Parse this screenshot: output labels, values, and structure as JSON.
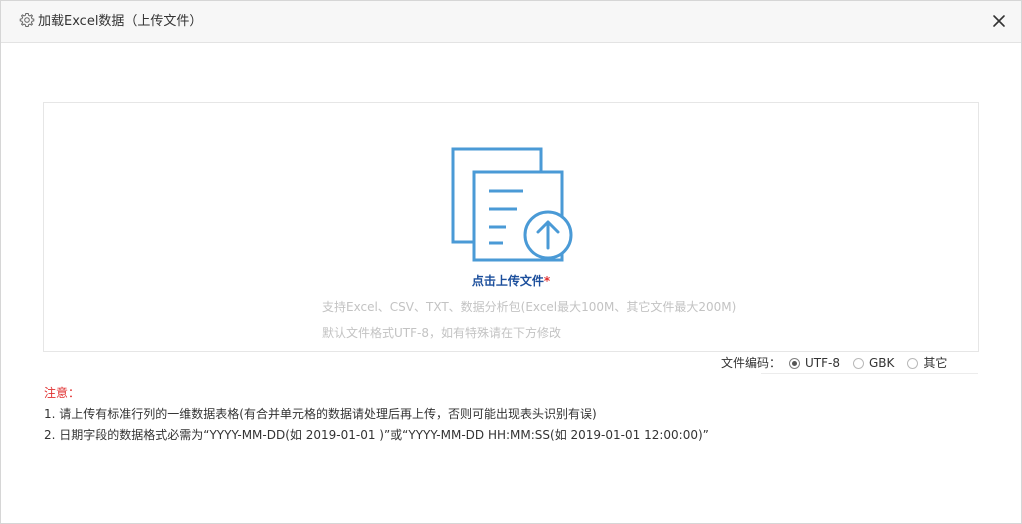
{
  "dialog": {
    "title": "加载Excel数据（上传文件）",
    "icons": {
      "title": "gear-icon",
      "close": "close-icon"
    }
  },
  "upload": {
    "label": "点击上传文件",
    "required_mark": "*",
    "hint_formats": "支持Excel、CSV、TXT、数据分析包(Excel最大100M、其它文件最大200M)",
    "hint_encoding": "默认文件格式UTF-8，如有特殊请在下方修改",
    "icon": "document-upload-icon",
    "accent_color": "#4a9ad6"
  },
  "encoding": {
    "label": "文件编码：",
    "options": [
      {
        "label": "UTF-8",
        "checked": true
      },
      {
        "label": "GBK",
        "checked": false
      },
      {
        "label": "其它",
        "checked": false
      }
    ]
  },
  "notes": {
    "title": "注意：",
    "items": [
      "1. 请上传有标准行列的一维数据表格(有合并单元格的数据请处理后再上传，否则可能出现表头识别有误)",
      "2. 日期字段的数据格式必需为“YYYY-MM-DD(如 2019-01-01 )”或“YYYY-MM-DD HH:MM:SS(如 2019-01-01 12:00:00)”"
    ]
  }
}
